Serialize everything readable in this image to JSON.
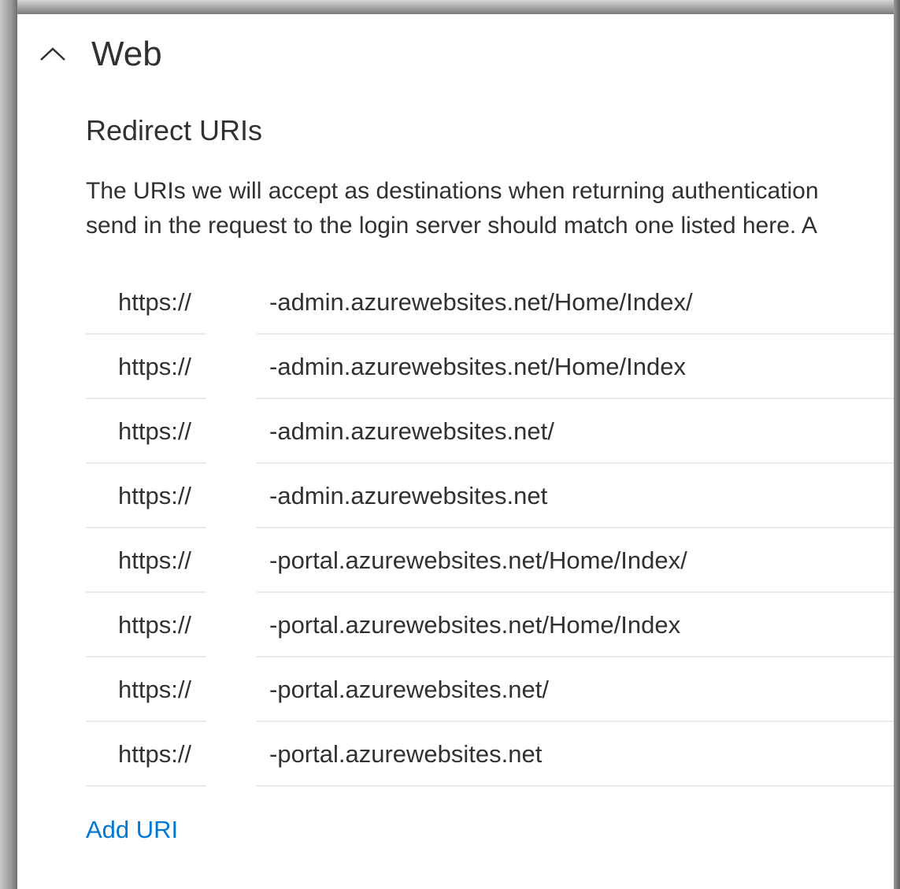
{
  "section": {
    "title": "Web",
    "toggle_icon": "chevron-up-icon"
  },
  "redirect": {
    "heading": "Redirect URIs",
    "description_line1": "The URIs we will accept as destinations when returning authentication",
    "description_line2": "send in the request to the login server should match one listed here. A"
  },
  "uris": [
    {
      "prefix": "https://",
      "suffix": "-admin.azurewebsites.net/Home/Index/"
    },
    {
      "prefix": "https://",
      "suffix": "-admin.azurewebsites.net/Home/Index"
    },
    {
      "prefix": "https://",
      "suffix": "-admin.azurewebsites.net/"
    },
    {
      "prefix": "https://",
      "suffix": "-admin.azurewebsites.net"
    },
    {
      "prefix": "https://",
      "suffix": "-portal.azurewebsites.net/Home/Index/"
    },
    {
      "prefix": "https://",
      "suffix": "-portal.azurewebsites.net/Home/Index"
    },
    {
      "prefix": "https://",
      "suffix": "-portal.azurewebsites.net/"
    },
    {
      "prefix": "https://",
      "suffix": "-portal.azurewebsites.net"
    }
  ],
  "actions": {
    "add_uri_label": "Add URI"
  },
  "colors": {
    "link": "#0078d4",
    "text": "#323130",
    "divider": "#edebe9"
  }
}
